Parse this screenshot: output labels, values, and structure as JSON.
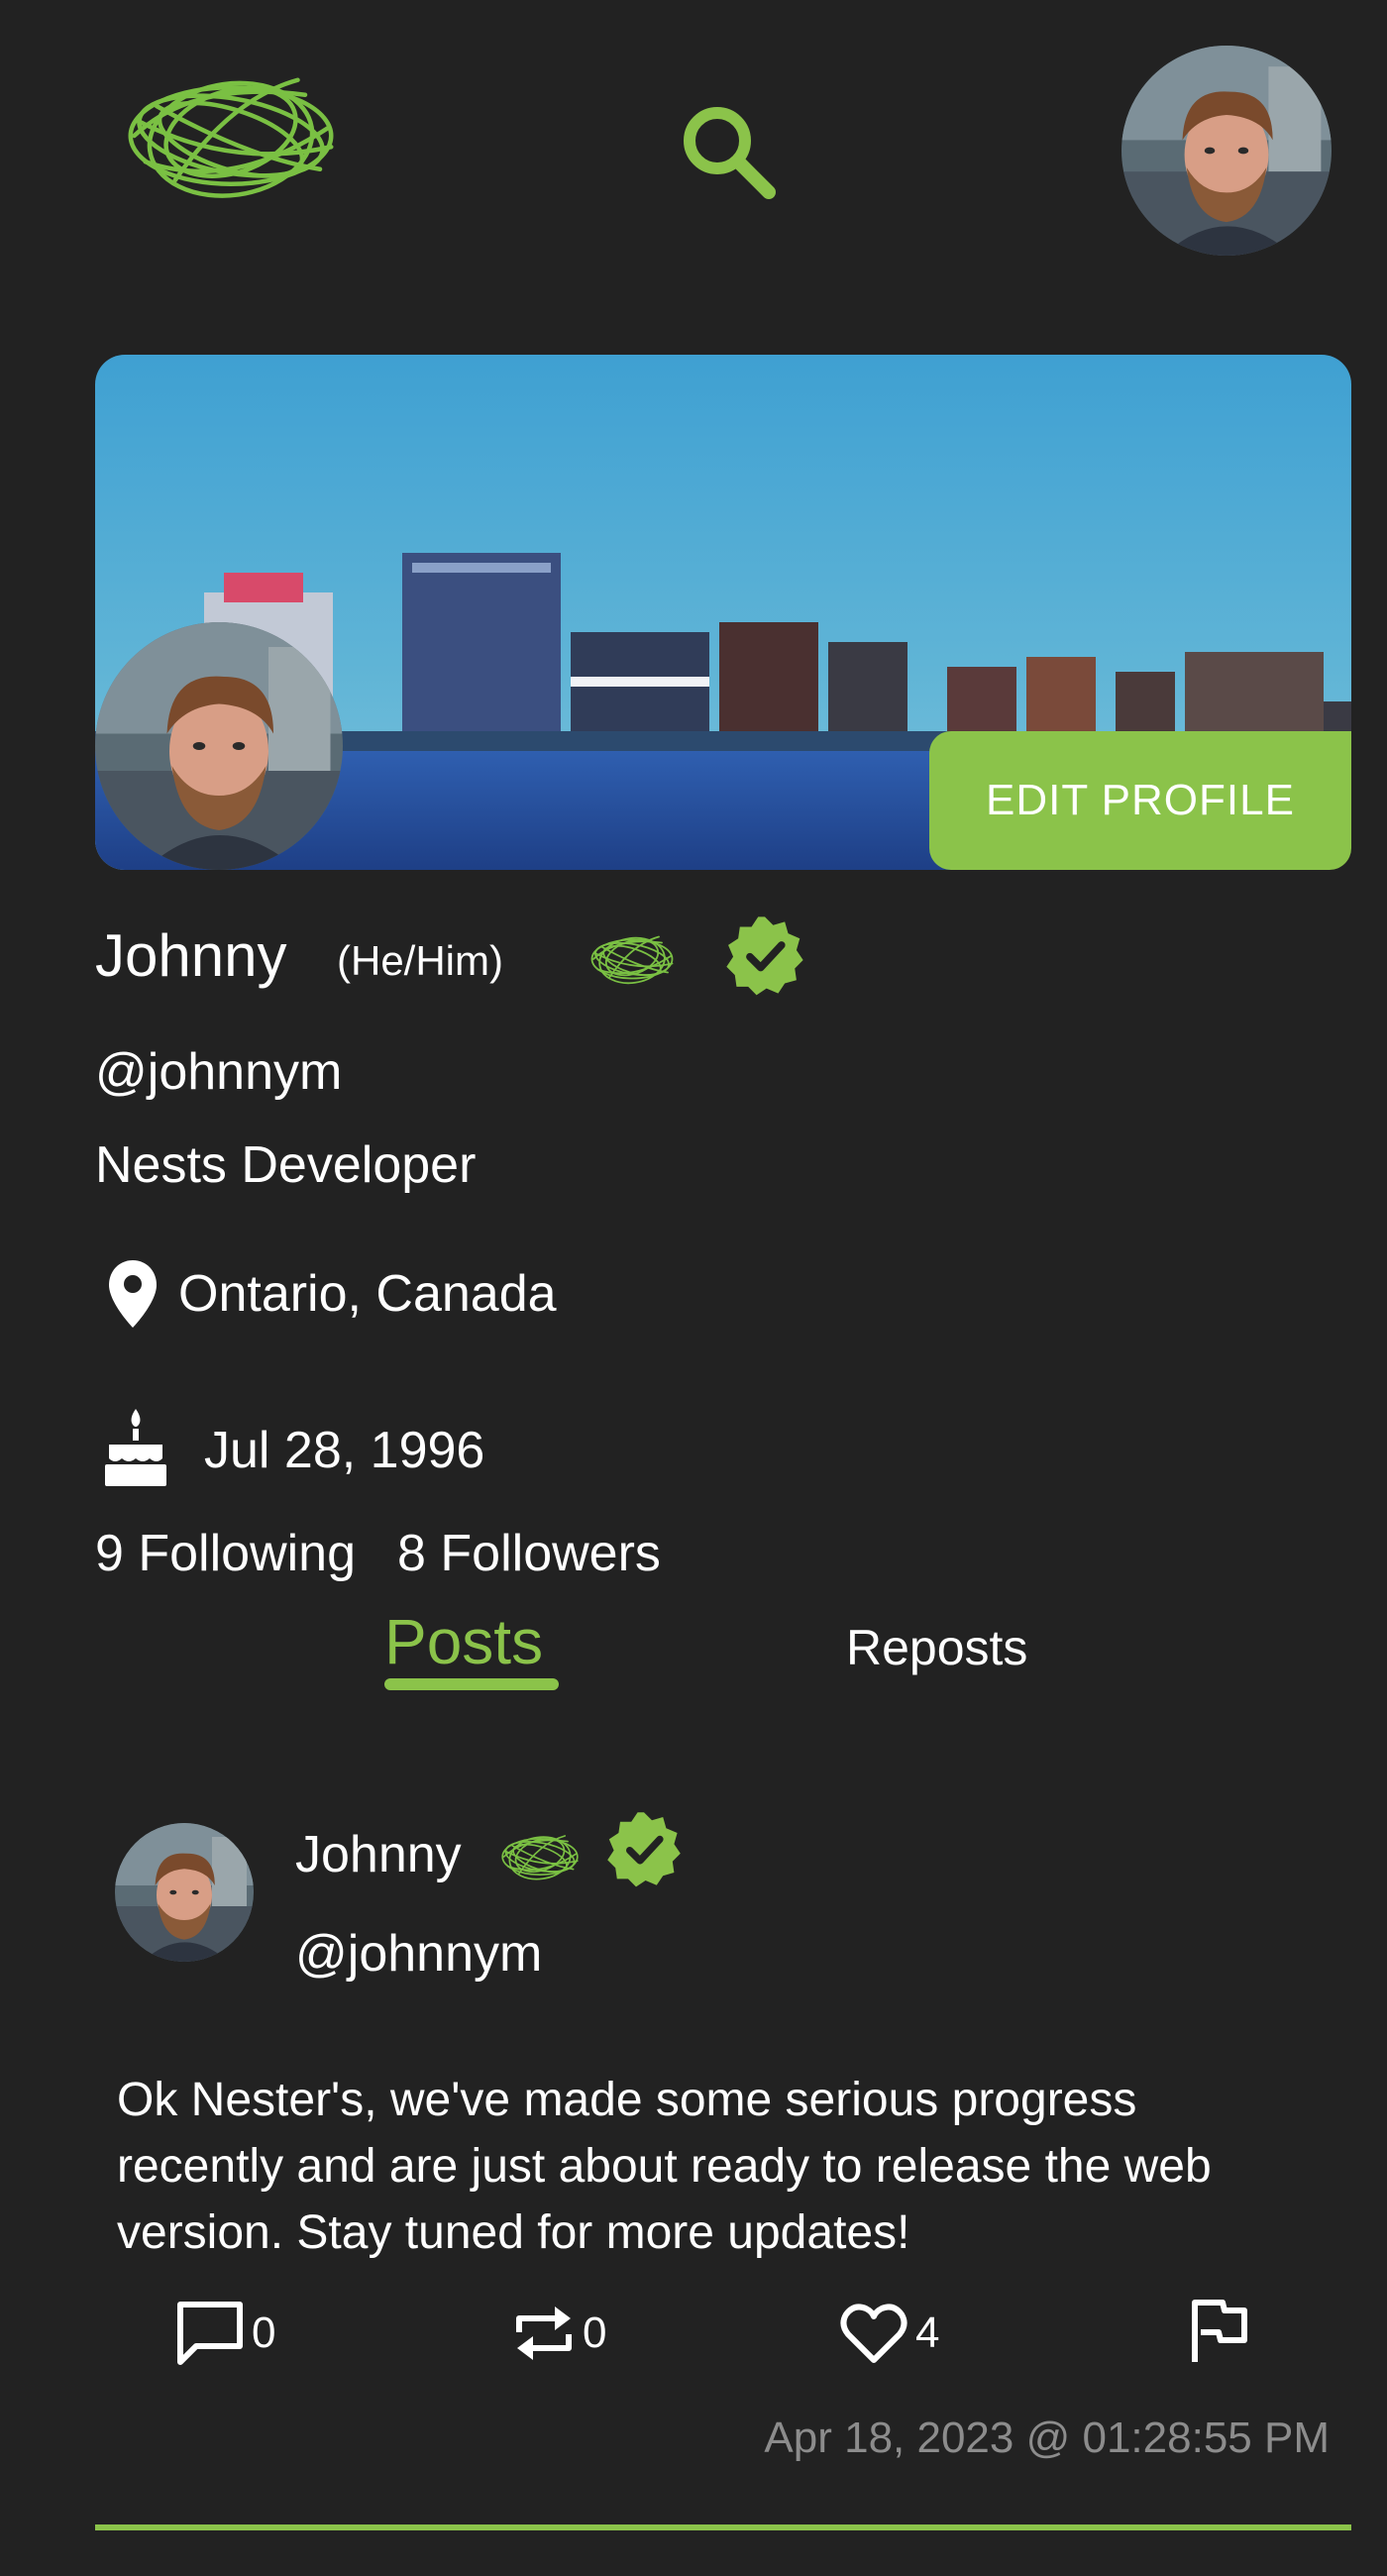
{
  "colors": {
    "accent": "#8bc34a",
    "background": "#222222",
    "text": "#ffffff",
    "muted": "#8c8c8c"
  },
  "header": {
    "logo_icon": "nest-logo-icon",
    "search_icon": "search-icon",
    "avatar": "user-avatar"
  },
  "profile": {
    "edit_button": "EDIT PROFILE",
    "name": "Johnny",
    "pronouns": "(He/Him)",
    "handle": "@johnnym",
    "bio": "Nests Developer",
    "location": "Ontario, Canada",
    "birthday": "Jul 28, 1996",
    "following": "9 Following",
    "followers": "8 Followers"
  },
  "tabs": {
    "posts": "Posts",
    "reposts": "Reposts",
    "active": "Posts"
  },
  "post": {
    "author_name": "Johnny",
    "author_handle": "@johnnym",
    "text": "Ok Nester's, we've made some serious progress recently and are just about ready to release the web version. Stay tuned for more updates!",
    "comments": "0",
    "reposts": "0",
    "likes": "4",
    "timestamp": "Apr 18, 2023 @ 01:28:55 PM"
  }
}
